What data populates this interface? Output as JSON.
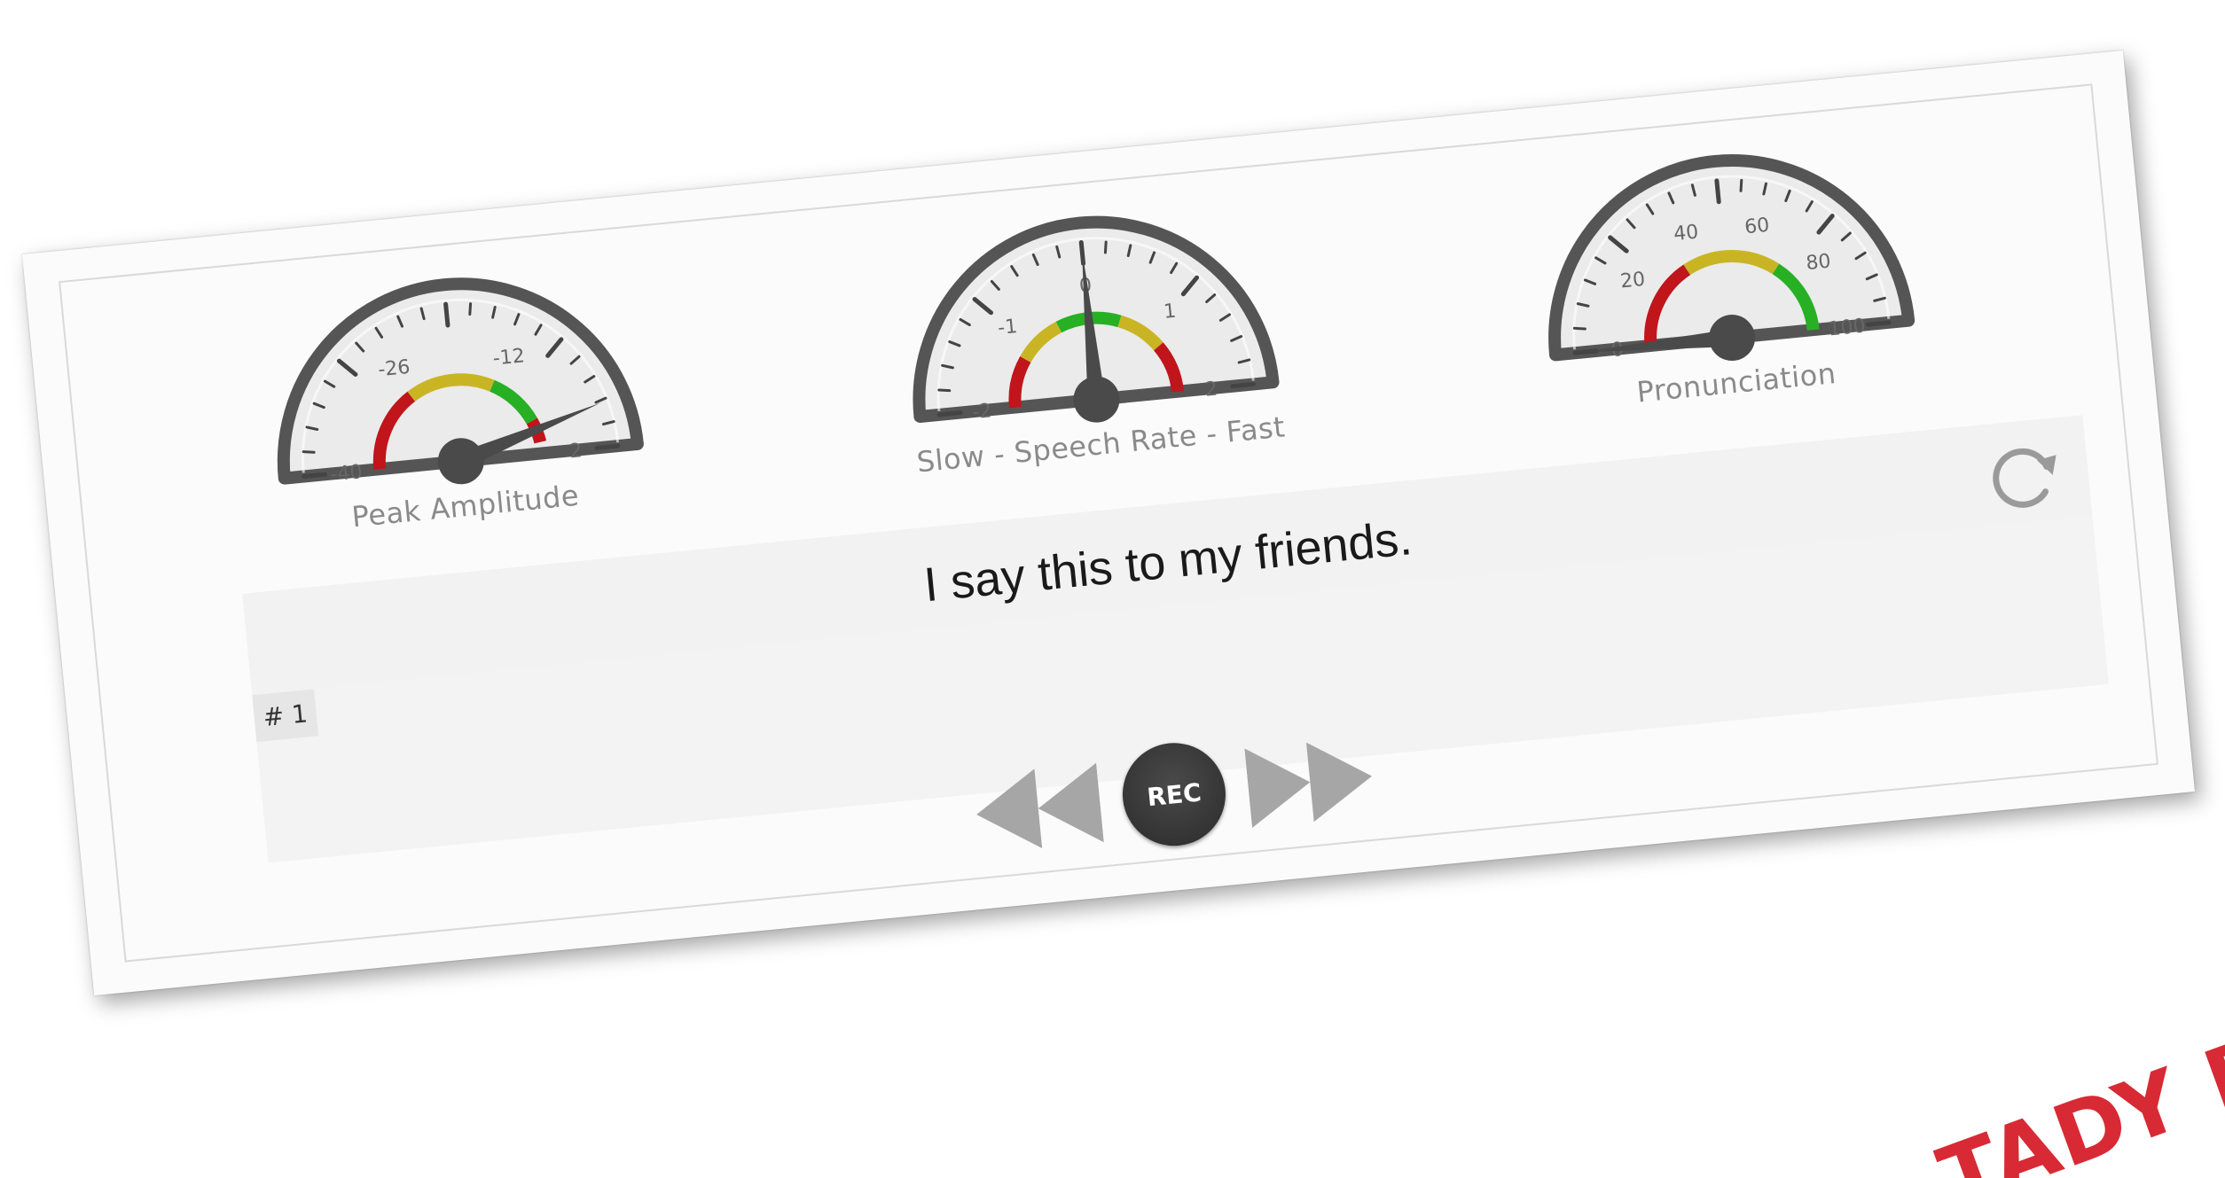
{
  "gauges": {
    "amplitude": {
      "label": "Peak Amplitude",
      "tick_labels": [
        "-40",
        "-26",
        "-12",
        "2"
      ],
      "min": -40,
      "max": 2,
      "value": -2
    },
    "speech_rate": {
      "label": "Slow - Speech Rate - Fast",
      "tick_labels": [
        "-2",
        "-1",
        "0",
        "1",
        "2"
      ],
      "min": -2,
      "max": 2,
      "value": 0
    },
    "pronunciation": {
      "label": "Pronunciation",
      "tick_labels": [
        "0",
        "20",
        "40",
        "60",
        "80",
        "100"
      ],
      "min": 0,
      "max": 100,
      "value": 0
    }
  },
  "sentence": {
    "text": "I say this to my friends."
  },
  "recording": {
    "item_number": "# 1"
  },
  "controls": {
    "rec_label": "REC"
  },
  "stamp": {
    "text": "TADY B"
  },
  "colors": {
    "red": "#c0151b",
    "yellow": "#c9b523",
    "green": "#27b024",
    "gauge_frame": "#555555",
    "gauge_face": "#ebebeb",
    "needle": "#4a4a4a"
  }
}
